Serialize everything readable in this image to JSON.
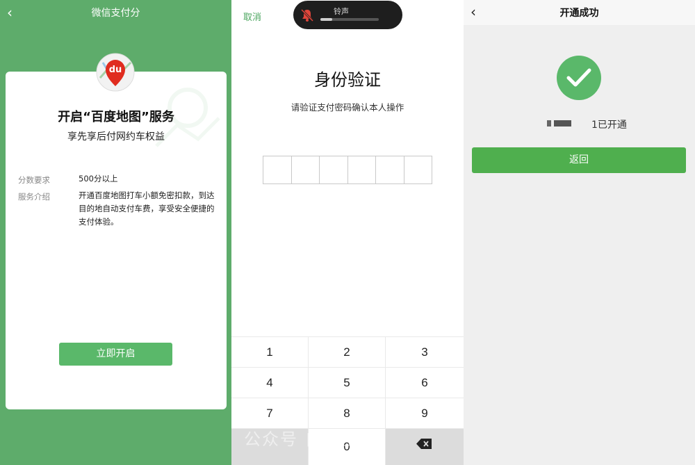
{
  "panel1": {
    "nav_title": "微信支付分",
    "back_icon": "chevron-left-icon",
    "logo_text": "du",
    "card_title": "开启“百度地图”服务",
    "card_subtitle": "享先享后付网约车权益",
    "score_label": "分数要求",
    "score_value": "500分以上",
    "service_label": "服务介绍",
    "service_value": "开通百度地图打车小额免密扣款，到达目的地自动支付车费，享受安全便捷的支付体验。",
    "open_button": "立即开启",
    "colors": {
      "background": "#5eac6b",
      "button": "#5ab86a",
      "logo_red": "#e02c1f"
    }
  },
  "panel2": {
    "cancel_label": "取消",
    "ringer": {
      "label": "铃声",
      "icon": "bell-muted-icon",
      "level": 0.2
    },
    "title": "身份验证",
    "hint": "请验证支付密码确认本人操作",
    "pin_length": 6,
    "keys": [
      "1",
      "2",
      "3",
      "4",
      "5",
      "6",
      "7",
      "8",
      "9",
      "0"
    ],
    "delete_icon": "backspace-icon",
    "watermark": "公众号   自习室"
  },
  "panel3": {
    "back_icon": "chevron-left-icon",
    "nav_title": "开通成功",
    "success_icon": "check-circle-icon",
    "status_text": "1已开通",
    "back_button": "返回",
    "colors": {
      "accent": "#5ab86a",
      "button": "#4faf4e"
    }
  }
}
